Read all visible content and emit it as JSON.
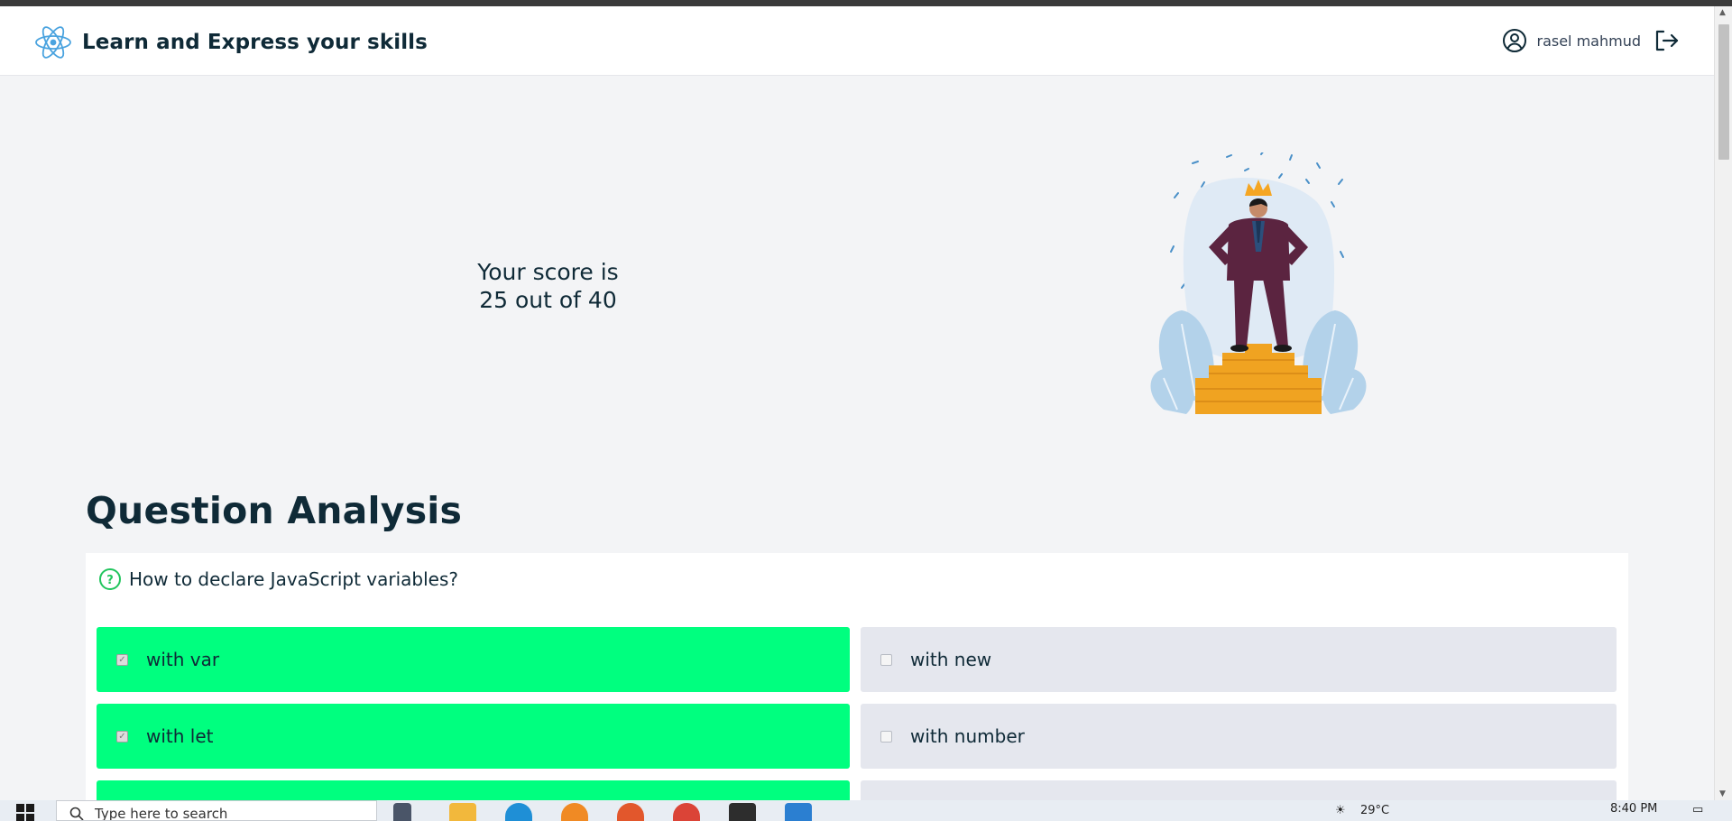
{
  "header": {
    "title": "Learn and Express your skills",
    "user_name": "rasel mahmud"
  },
  "result": {
    "line1": "Your score is",
    "line2": "25 out of 40"
  },
  "analysis": {
    "title": "Question Analysis",
    "question": "How to declare JavaScript variables?",
    "options": [
      {
        "label": "with var",
        "checked": true,
        "correct": true
      },
      {
        "label": "with new",
        "checked": false,
        "correct": false
      },
      {
        "label": "with let",
        "checked": true,
        "correct": true
      },
      {
        "label": "with number",
        "checked": false,
        "correct": false
      }
    ],
    "colors": {
      "correct": "#00ff7f",
      "plain": "#e5e7ee"
    }
  },
  "taskbar": {
    "search_placeholder": "Type here to search",
    "weather": "29°C",
    "time": "8:40 PM"
  }
}
